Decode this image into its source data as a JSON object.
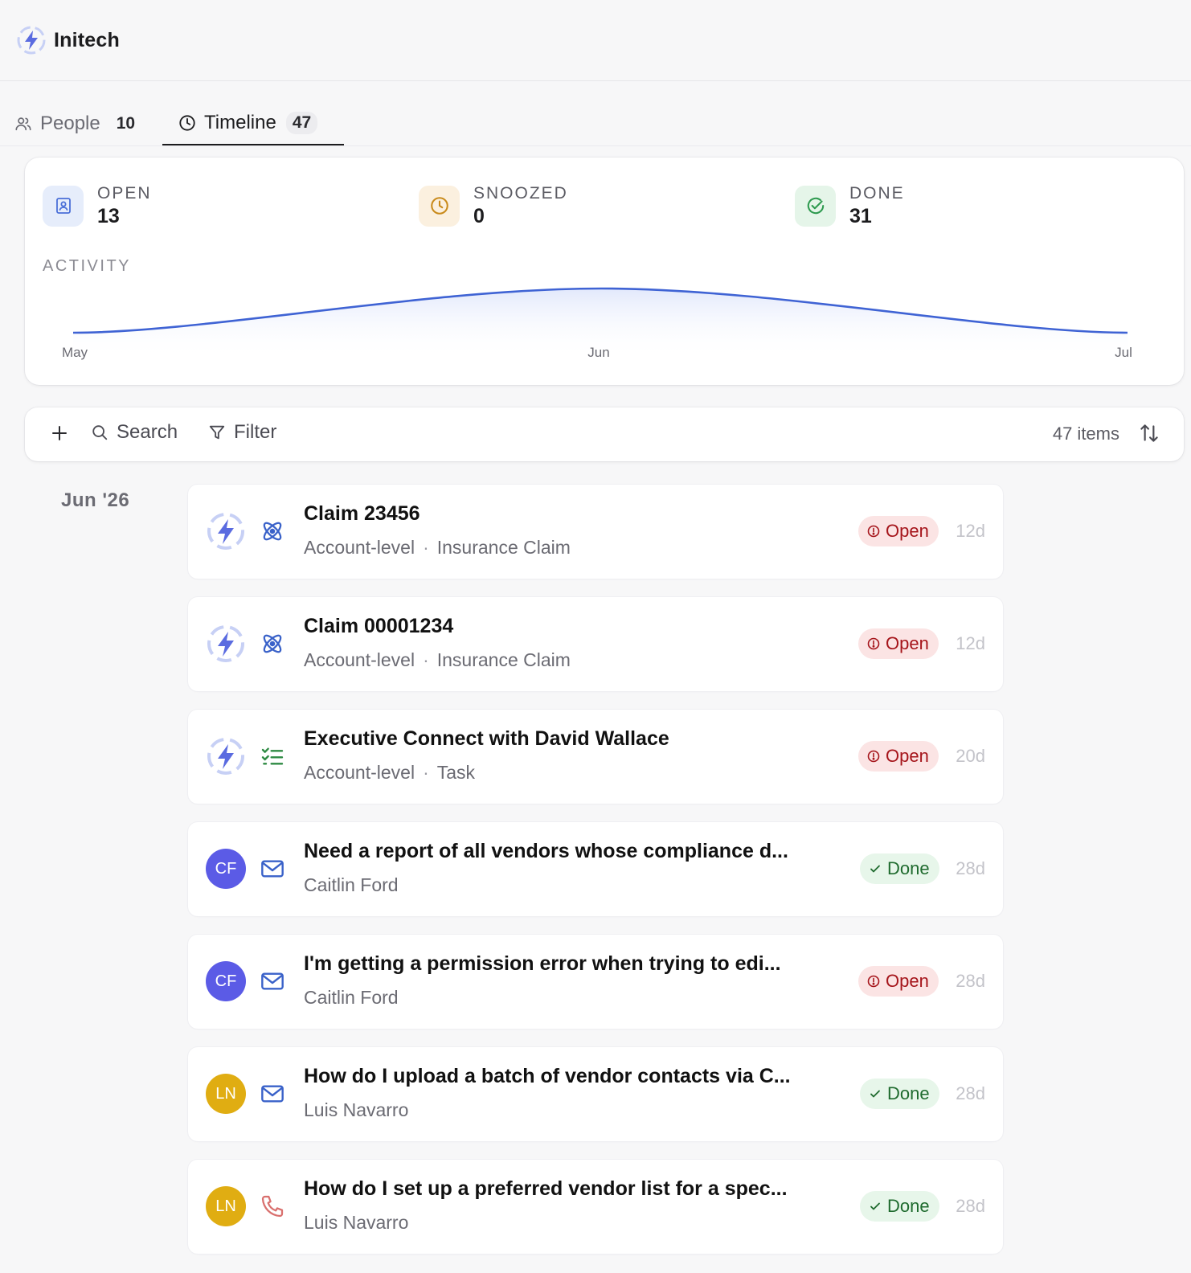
{
  "header": {
    "org_name": "Initech"
  },
  "tabs": [
    {
      "label": "People",
      "count": "10",
      "icon": "people-icon"
    },
    {
      "label": "Timeline",
      "count": "47",
      "icon": "clock-icon"
    }
  ],
  "stats": [
    {
      "label": "OPEN",
      "value": "13",
      "icon": "contact-card-icon",
      "color": "#4a6fd8"
    },
    {
      "label": "SNOOZED",
      "value": "0",
      "icon": "clock-icon",
      "color": "#c98a1a"
    },
    {
      "label": "DONE",
      "value": "31",
      "icon": "check-circle-icon",
      "color": "#2e9a4f"
    }
  ],
  "activity": {
    "label": "ACTIVITY",
    "ticks": [
      "May",
      "Jun",
      "Jul"
    ]
  },
  "toolbar": {
    "add_label": "+",
    "search_label": "Search",
    "filter_label": "Filter",
    "count_label": "47 items"
  },
  "group_label": "Jun '26",
  "items": [
    {
      "title": "Claim 23456",
      "sub1": "Account-level",
      "sub2": "Insurance Claim",
      "status": "Open",
      "age": "12d",
      "avatar": "initech-logo",
      "type_icon": "atom-icon"
    },
    {
      "title": "Claim 00001234",
      "sub1": "Account-level",
      "sub2": "Insurance Claim",
      "status": "Open",
      "age": "12d",
      "avatar": "initech-logo",
      "type_icon": "atom-icon"
    },
    {
      "title": "Executive Connect with David Wallace",
      "sub1": "Account-level",
      "sub2": "Task",
      "status": "Open",
      "age": "20d",
      "avatar": "initech-logo",
      "type_icon": "checklist-icon"
    },
    {
      "title": "Need a report of all vendors whose compliance d...",
      "sub1": "Caitlin Ford",
      "status": "Done",
      "age": "28d",
      "avatar": "CF",
      "avatar_color": "#5b5be6",
      "type_icon": "mail-icon"
    },
    {
      "title": "I'm getting a permission error when trying to edi...",
      "sub1": "Caitlin Ford",
      "status": "Open",
      "age": "28d",
      "avatar": "CF",
      "avatar_color": "#5b5be6",
      "type_icon": "mail-icon"
    },
    {
      "title": "How do I upload a batch of vendor contacts via C...",
      "sub1": "Luis Navarro",
      "status": "Done",
      "age": "28d",
      "avatar": "LN",
      "avatar_color": "#e0ad12",
      "type_icon": "mail-icon"
    },
    {
      "title": "How do I set up a preferred vendor list for a spec...",
      "sub1": "Luis Navarro",
      "status": "Done",
      "age": "28d",
      "avatar": "LN",
      "avatar_color": "#e0ad12",
      "type_icon": "phone-icon"
    }
  ]
}
